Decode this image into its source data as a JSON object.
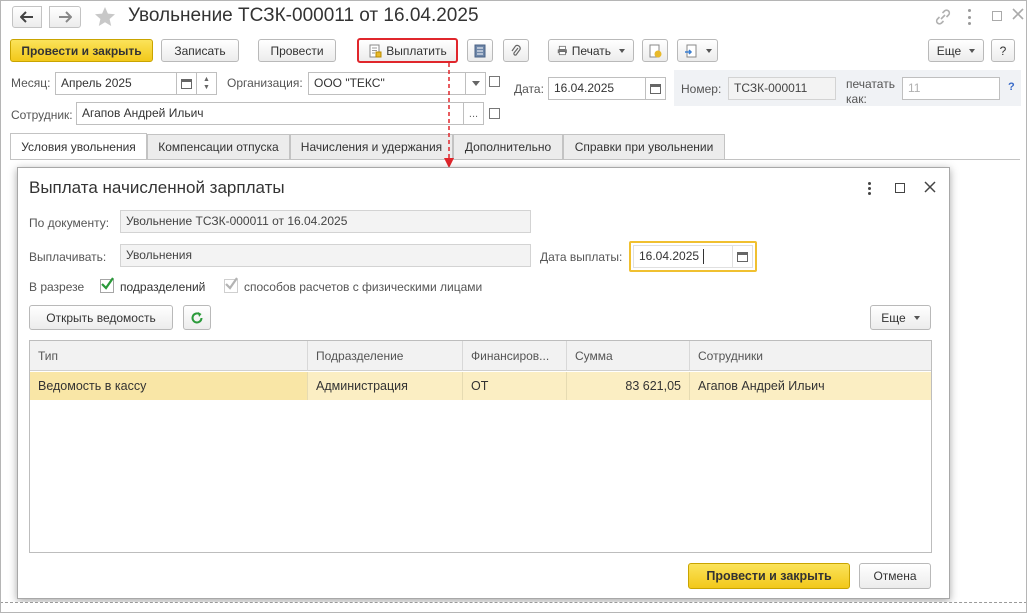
{
  "window": {
    "title": "Увольнение ТСЗК-000011 от 16.04.2025"
  },
  "toolbar": {
    "post_close": "Провести и закрыть",
    "save": "Записать",
    "post": "Провести",
    "pay": "Выплатить",
    "print": "Печать",
    "more": "Еще",
    "help": "?"
  },
  "header": {
    "month_label": "Месяц:",
    "month_value": "Апрель 2025",
    "org_label": "Организация:",
    "org_value": "ООО \"ТЕКС\"",
    "date_label": "Дата:",
    "date_value": "16.04.2025",
    "number_label": "Номер:",
    "number_value": "ТСЗК-000011",
    "print_as_label_1": "печатать",
    "print_as_label_2": "как:",
    "print_as_value": "11",
    "help": "?",
    "employee_label": "Сотрудник:",
    "employee_value": "Агапов Андрей Ильич",
    "ellipsis": "..."
  },
  "tabs": [
    {
      "label": "Условия увольнения",
      "active": true
    },
    {
      "label": "Компенсации отпуска"
    },
    {
      "label": "Начисления и удержания"
    },
    {
      "label": "Дополнительно"
    },
    {
      "label": "Справки при увольнении"
    }
  ],
  "modal": {
    "title": "Выплата начисленной зарплаты",
    "doc_label": "По документу:",
    "doc_value": "Увольнение ТСЗК-000011 от 16.04.2025",
    "pay_label": "Выплачивать:",
    "pay_value": "Увольнения",
    "paydate_label": "Дата выплаты:",
    "paydate_value": "16.04.2025",
    "breakdown_label": "В разрезе",
    "cb_divisions": "подразделений",
    "cb_methods": "способов расчетов с физическими лицами",
    "open_statement": "Открыть ведомость",
    "more": "Еще",
    "ok": "Провести и закрыть",
    "cancel": "Отмена",
    "columns": [
      "Тип",
      "Подразделение",
      "Финансиров...",
      "Сумма",
      "Сотрудники"
    ],
    "rows": [
      [
        "Ведомость в кассу",
        "Администрация",
        "ОТ",
        "83 621,05",
        "Агапов Андрей Ильич"
      ]
    ]
  },
  "colors": {
    "accent_yellow": "#f2c81a",
    "highlight_red": "#e0262c",
    "row_selected": "#fbeec3",
    "focus_border": "#f0c030"
  }
}
